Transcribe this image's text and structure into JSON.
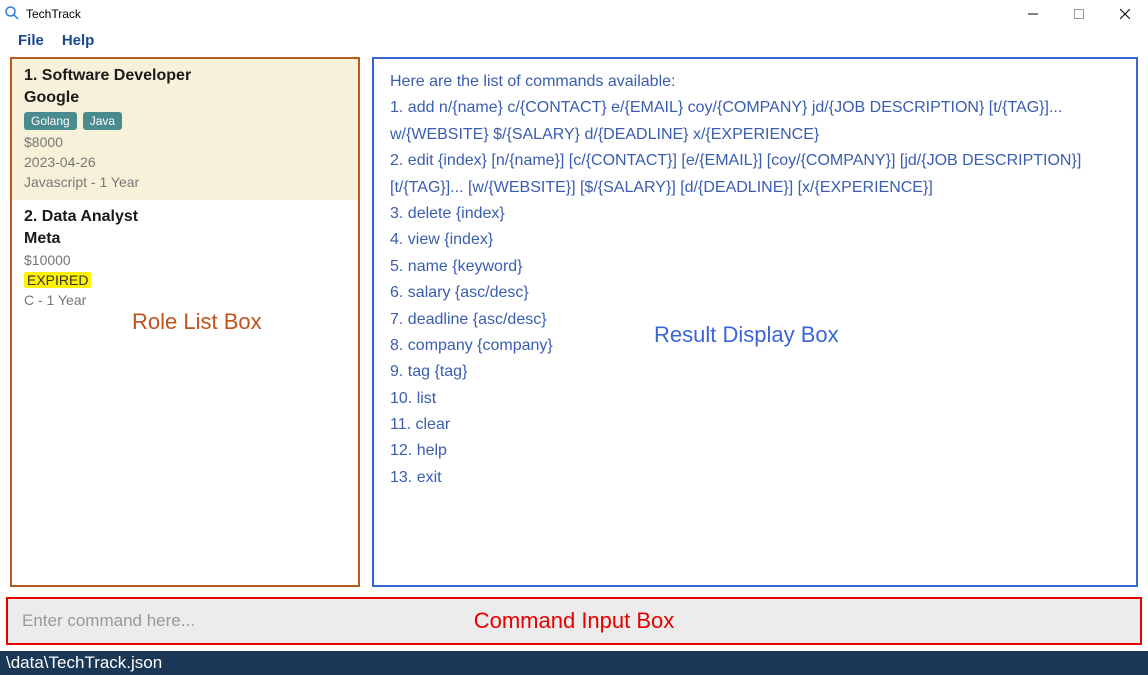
{
  "window": {
    "title": "TechTrack"
  },
  "menu": {
    "file": "File",
    "help": "Help"
  },
  "roles": [
    {
      "index": "1.",
      "title": "Software Developer",
      "company": "Google",
      "tags": [
        "Golang",
        "Java"
      ],
      "salary": "$8000",
      "date": "2023-04-26",
      "date_expired": false,
      "exp": "Javascript - 1 Year",
      "selected": true
    },
    {
      "index": "2.",
      "title": "Data Analyst",
      "company": "Meta",
      "tags": [],
      "salary": "$10000",
      "date": "EXPIRED",
      "date_expired": true,
      "exp": "C - 1 Year",
      "selected": false
    }
  ],
  "result": {
    "header": "Here are the list of commands available:",
    "lines": [
      "1. add n/{name} c/{CONTACT} e/{EMAIL} coy/{COMPANY} jd/{JOB DESCRIPTION} [t/{TAG}]... w/{WEBSITE} $/{SALARY} d/{DEADLINE} x/{EXPERIENCE}",
      "2. edit {index} [n/{name}] [c/{CONTACT}] [e/{EMAIL}] [coy/{COMPANY}] [jd/{JOB DESCRIPTION}] [t/{TAG}]... [w/{WEBSITE}] [$/{SALARY}] [d/{DEADLINE}] [x/{EXPERIENCE}]",
      "3. delete {index}",
      "4. view {index}",
      "5. name {keyword}",
      "6. salary {asc/desc}",
      "7. deadline {asc/desc}",
      "8. company {company}",
      "9. tag {tag}",
      "10. list",
      "11. clear",
      "12. help",
      "13. exit"
    ]
  },
  "command_input": {
    "placeholder": "Enter command here...",
    "value": ""
  },
  "statusbar": {
    "path": "\\data\\TechTrack.json"
  },
  "annotations": {
    "role_list": "Role List Box",
    "result_display": "Result Display Box",
    "command_input": "Command Input Box"
  }
}
